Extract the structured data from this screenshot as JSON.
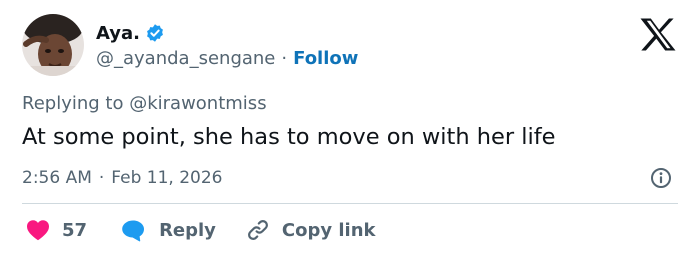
{
  "author": {
    "name": "Aya.",
    "handle": "@_ayanda_sengane",
    "separator": "·",
    "follow_label": "Follow",
    "verified": true
  },
  "reply_context": {
    "prefix": "Replying to",
    "mention": "@kirawontmiss"
  },
  "tweet": {
    "text": "At some point, she has to move on with her life",
    "time": "2:56 AM",
    "separator": "·",
    "date": "Feb 11, 2026"
  },
  "actions": {
    "like_count": "57",
    "reply_label": "Reply",
    "copy_link_label": "Copy link"
  },
  "icons": {
    "verified": "verified-badge-icon",
    "brand": "x-logo-icon",
    "info": "info-icon",
    "like": "heart-icon",
    "reply": "speech-bubble-icon",
    "copy": "link-icon"
  },
  "colors": {
    "text": "#0f1419",
    "secondary": "#536471",
    "link": "#0f73b8",
    "verified": "#1d9bf0",
    "like": "#f91880",
    "reply": "#1d9bf0",
    "divider": "#cfd9de"
  }
}
